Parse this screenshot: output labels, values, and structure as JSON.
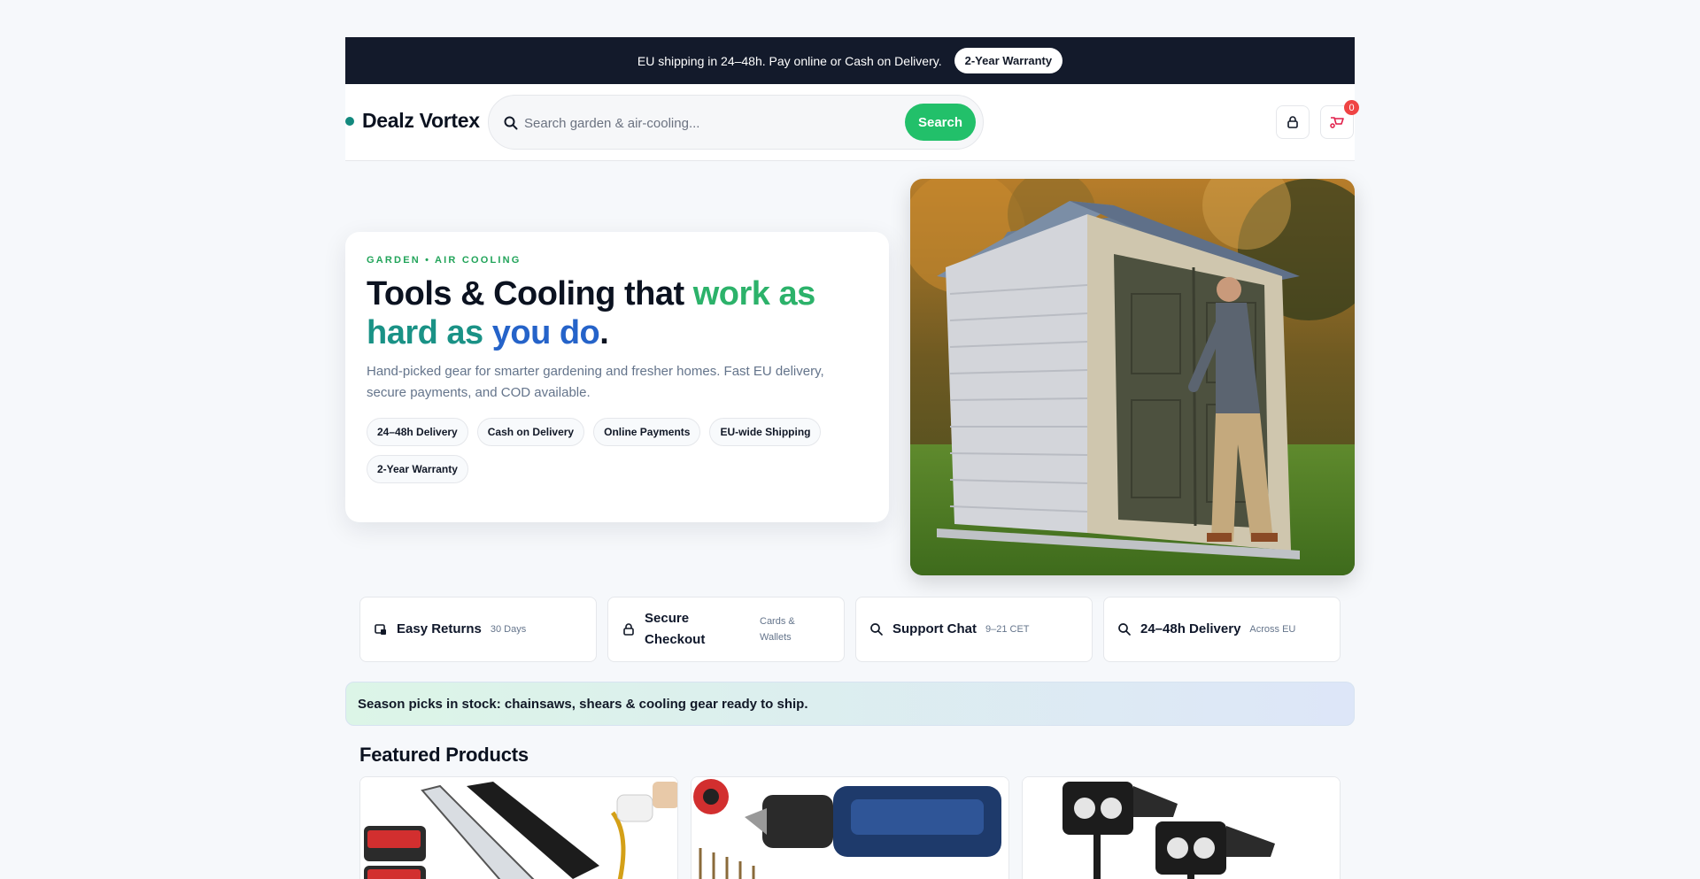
{
  "topbar": {
    "message": "EU shipping in 24–48h. Pay online or Cash on Delivery.",
    "pill": "2-Year Warranty"
  },
  "header": {
    "brand": "Dealz Vortex",
    "search_placeholder": "Search garden & air-cooling...",
    "search_button": "Search",
    "cart_count": "0"
  },
  "hero": {
    "eyebrow": "GARDEN • AIR COOLING",
    "title_part1": "Tools & Cooling that ",
    "title_part2": "work as",
    "title_part3": "hard as ",
    "title_part4": "you do",
    "title_part5": ".",
    "description": "Hand-picked gear for smarter gardening and fresher homes. Fast EU delivery, secure payments, and COD available.",
    "chips": [
      "24–48h Delivery",
      "Cash on Delivery",
      "Online Payments",
      "EU-wide Shipping",
      "2-Year Warranty"
    ]
  },
  "features": [
    {
      "title": "Easy Returns",
      "sub": "30 Days",
      "icon": "return-box-icon"
    },
    {
      "title": "Secure Checkout",
      "sub": "Cards & Wallets",
      "icon": "lock-icon"
    },
    {
      "title": "Support Chat",
      "sub": "9–21 CET",
      "icon": "search-icon"
    },
    {
      "title": "24–48h Delivery",
      "sub": "Across EU",
      "icon": "search-icon"
    }
  ],
  "banner": "Season picks in stock: chainsaws, shears & cooling gear ready to ship.",
  "featured": {
    "title": "Featured Products"
  },
  "colors": {
    "accent_green": "#22c06a",
    "teal": "#1a9286",
    "blue": "#2563c9",
    "topbar_bg": "#131a2b",
    "badge_red": "#ef4444"
  }
}
